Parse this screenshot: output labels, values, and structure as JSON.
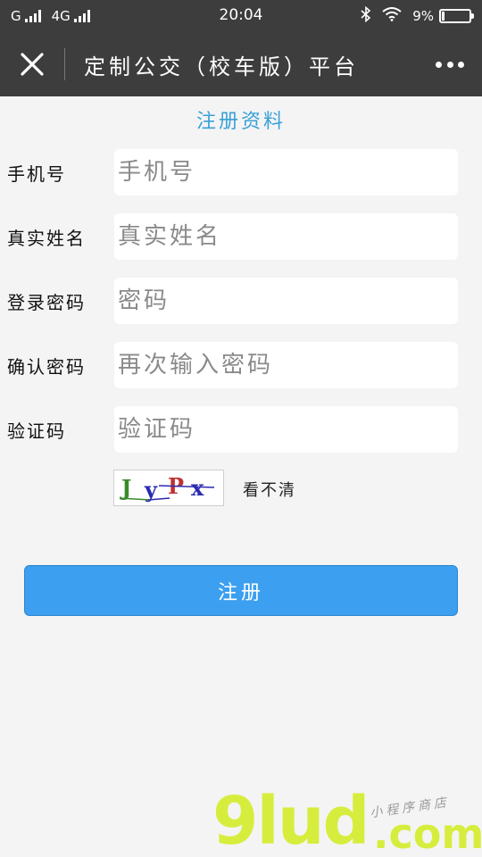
{
  "status_bar": {
    "carrier1": "G",
    "carrier2": "4G",
    "time": "20:04",
    "battery": "9%"
  },
  "nav": {
    "title": "定制公交（校车版）平台"
  },
  "form": {
    "title": "注册资料",
    "fields": [
      {
        "label": "手机号",
        "placeholder": "手机号",
        "value": ""
      },
      {
        "label": "真实姓名",
        "placeholder": "真实姓名",
        "value": ""
      },
      {
        "label": "登录密码",
        "placeholder": "密码",
        "value": ""
      },
      {
        "label": "确认密码",
        "placeholder": "再次输入密码",
        "value": ""
      },
      {
        "label": "验证码",
        "placeholder": "验证码",
        "value": ""
      }
    ],
    "captcha_text": "JyPx",
    "captcha_chars": [
      "J",
      "y",
      "P",
      "x"
    ],
    "captcha_refresh": "看不清",
    "submit_label": "注册"
  },
  "watermark": {
    "brand": "9lud",
    "domain": ".com",
    "subtitle": "小程序商店"
  },
  "colors": {
    "top_bar": "#3d3d3d",
    "accent": "#3aa0d8",
    "button": "#3c9ff0",
    "background": "#f4f4f4"
  }
}
